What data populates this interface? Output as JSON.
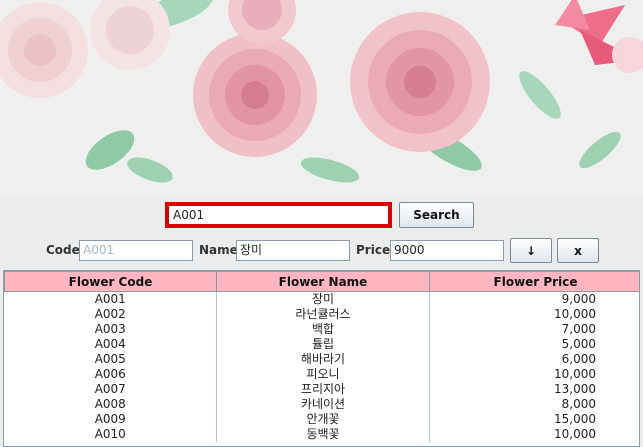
{
  "search": {
    "value": "A001",
    "button_label": "Search"
  },
  "form": {
    "code_label": "Code",
    "code_value": "A001",
    "name_label": "Name",
    "name_value": "장미",
    "price_label": "Price",
    "price_value": "9000",
    "down_button_label": "↓",
    "delete_button_label": "x"
  },
  "table": {
    "headers": [
      "Flower Code",
      "Flower Name",
      "Flower Price"
    ],
    "rows": [
      [
        "A001",
        "장미",
        "9,000"
      ],
      [
        "A002",
        "라넌큘러스",
        "10,000"
      ],
      [
        "A003",
        "백합",
        "7,000"
      ],
      [
        "A004",
        "튤립",
        "5,000"
      ],
      [
        "A005",
        "해바라기",
        "6,000"
      ],
      [
        "A006",
        "피오니",
        "10,000"
      ],
      [
        "A007",
        "프리지아",
        "13,000"
      ],
      [
        "A008",
        "카네이션",
        "8,000"
      ],
      [
        "A009",
        "안개꽃",
        "15,000"
      ],
      [
        "A010",
        "동백꽃",
        "10,000"
      ]
    ]
  },
  "colors": {
    "header_bg": "#ffb6c1",
    "search_border": "#e00000",
    "rose_pink": "#e8a3b0",
    "leaf_green": "#8fc9a6"
  }
}
